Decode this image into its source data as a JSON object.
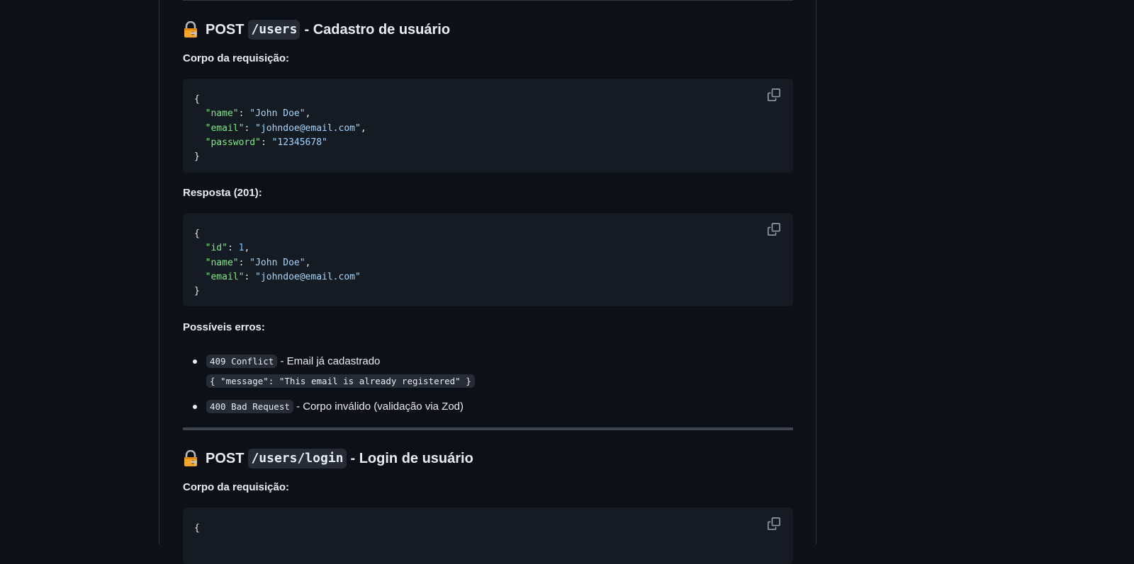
{
  "section1": {
    "method": "POST",
    "path": "/users",
    "title_rest": "- Cadastro de usuário",
    "body_label": "Corpo da requisição:",
    "request_code": {
      "open": "{",
      "lines": [
        {
          "key": "\"name\"",
          "sep": ": ",
          "value": "\"John Doe\"",
          "value_type": "string",
          "trail": ","
        },
        {
          "key": "\"email\"",
          "sep": ": ",
          "value": "\"johndoe@email.com\"",
          "value_type": "string",
          "trail": ","
        },
        {
          "key": "\"password\"",
          "sep": ": ",
          "value": "\"12345678\"",
          "value_type": "string",
          "trail": ""
        }
      ],
      "close": "}"
    },
    "response_label": "Resposta (201):",
    "response_code": {
      "open": "{",
      "lines": [
        {
          "key": "\"id\"",
          "sep": ": ",
          "value": "1",
          "value_type": "number",
          "trail": ","
        },
        {
          "key": "\"name\"",
          "sep": ": ",
          "value": "\"John Doe\"",
          "value_type": "string",
          "trail": ","
        },
        {
          "key": "\"email\"",
          "sep": ": ",
          "value": "\"johndoe@email.com\"",
          "value_type": "string",
          "trail": ""
        }
      ],
      "close": "}"
    },
    "errors_label": "Possíveis erros:",
    "errors": [
      {
        "code": "409 Conflict",
        "desc": "- Email já cadastrado",
        "detail": "{ \"message\": \"This email is already registered\" }"
      },
      {
        "code": "400 Bad Request",
        "desc": "- Corpo inválido (validação via Zod)",
        "detail": ""
      }
    ]
  },
  "section2": {
    "method": "POST",
    "path": "/users/login",
    "title_rest": "- Login de usuário",
    "body_label": "Corpo da requisição:",
    "request_code_first_line": "{"
  },
  "icons": {
    "lock": "locked-with-key-icon",
    "copy": "copy-icon"
  },
  "colors": {
    "background": "#0d1117",
    "code_background": "#151b23",
    "json_key": "#7ee787",
    "json_string": "#a5d6ff",
    "json_number": "#79c0ff",
    "text": "#e6edf3"
  }
}
